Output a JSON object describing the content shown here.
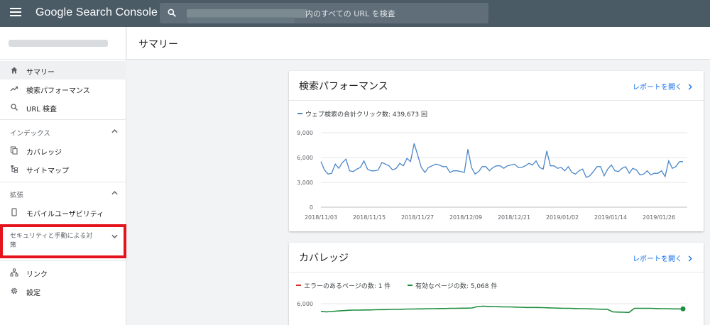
{
  "app": {
    "brand": "Google Search Console",
    "search_placeholder": "内のすべての URL を検査"
  },
  "sidebar": {
    "items_top": [
      {
        "label": "サマリー",
        "icon": "home-icon",
        "active": true
      },
      {
        "label": "検索パフォーマンス",
        "icon": "trending-up-icon"
      },
      {
        "label": "URL 検査",
        "icon": "search-icon"
      }
    ],
    "index_section": {
      "label": "インデックス",
      "items": [
        {
          "label": "カバレッジ",
          "icon": "copy-icon"
        },
        {
          "label": "サイトマップ",
          "icon": "sitemap-icon"
        }
      ]
    },
    "enhancements_section": {
      "label": "拡張",
      "items": [
        {
          "label": "モバイルユーザビリティ",
          "icon": "phone-icon"
        }
      ]
    },
    "security_section": {
      "label": "セキュリティと手動による対策"
    },
    "bottom_items": [
      {
        "label": "リンク",
        "icon": "links-icon"
      },
      {
        "label": "設定",
        "icon": "gear-icon"
      }
    ]
  },
  "main": {
    "title": "サマリー"
  },
  "performance_card": {
    "title": "検索パフォーマンス",
    "link": "レポートを開く",
    "legend": "ウェブ検索の合計クリック数: 439,673 回",
    "series_color": "#4a86c8"
  },
  "coverage_card": {
    "title": "カバレッジ",
    "link": "レポートを開く",
    "legend_error": "エラーのあるページの数: 1 件",
    "legend_valid": "有効なページの数: 5,068 件",
    "error_color": "#d93025",
    "valid_color": "#1e8e3e",
    "y_top_label": "6,000"
  },
  "chart_data": [
    {
      "type": "line",
      "series": [
        {
          "name": "ウェブ検索の合計クリック数",
          "values": [
            5500,
            4500,
            4000,
            4100,
            5200,
            4700,
            5400,
            5800,
            4400,
            4300,
            4600,
            4800,
            5600,
            4600,
            4400,
            4400,
            4500,
            5400,
            5200,
            5000,
            4500,
            4700,
            5300,
            5000,
            5900,
            5500,
            7700,
            6300,
            4800,
            4200,
            4800,
            5000,
            5200,
            5100,
            4900,
            4900,
            4200,
            4400,
            4400,
            4300,
            4200,
            7000,
            4800,
            4000,
            4300,
            4900,
            4900,
            4400,
            4800,
            5000,
            5000,
            4700,
            5000,
            5100,
            5200,
            4800,
            4800,
            5000,
            5300,
            5100,
            5600,
            4800,
            4600,
            6800,
            5000,
            5000,
            4700,
            4800,
            4400,
            4900,
            4200,
            4000,
            4400,
            4600,
            3600,
            3800,
            4300,
            4900,
            4900,
            3800,
            4600,
            5100,
            4400,
            4300,
            4700,
            4900,
            4100,
            4700,
            4500,
            3900,
            4000,
            4400,
            3900,
            4100,
            4100,
            4400,
            3700,
            5600,
            4700,
            4900,
            5500,
            5500
          ]
        }
      ],
      "x_ticks": [
        "2018/11/03",
        "2018/11/15",
        "2018/11/27",
        "2018/12/09",
        "2018/12/21",
        "2019/01/02",
        "2019/01/14",
        "2019/01/26"
      ],
      "y_ticks": [
        "9,000",
        "6,000",
        "3,000",
        "0"
      ],
      "ylim": [
        0,
        9000
      ]
    },
    {
      "type": "line",
      "series": [
        {
          "name": "有効なページの数",
          "values": [
            4930,
            4900,
            4920,
            4950,
            4970,
            4990,
            5000,
            5000,
            5010,
            5010,
            5020,
            5030,
            5030,
            5040,
            5040,
            5050,
            5060,
            5060,
            5070,
            5070,
            5080,
            5080,
            5090,
            5090,
            5100,
            5100,
            5110,
            5110,
            5120,
            5200,
            5220,
            5210,
            5200,
            5190,
            5180,
            5180,
            5170,
            5160,
            5150,
            5150,
            5150,
            5140,
            5130,
            5120,
            5110,
            5100,
            5100,
            5090,
            5080,
            5080,
            5070,
            5060,
            5050,
            5050,
            4900,
            4890,
            4880,
            4870,
            5100,
            5100,
            5100,
            5100,
            5090,
            5080,
            5080,
            5070,
            5070,
            5068
          ]
        },
        {
          "name": "エラーのあるページの数",
          "values": [
            1
          ]
        }
      ],
      "y_ticks": [
        "6,000"
      ]
    }
  ]
}
